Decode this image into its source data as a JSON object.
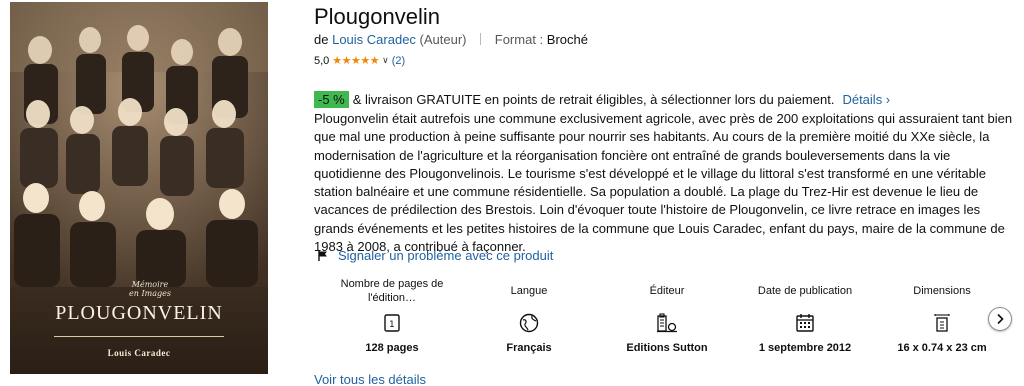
{
  "cover": {
    "series_line1": "Mémoire",
    "series_line2": "en Images",
    "title": "Plougonvelin",
    "author": "Louis Caradec"
  },
  "product": {
    "title": "Plougonvelin",
    "by_prefix": "de",
    "author": "Louis Caradec",
    "author_role": "(Auteur)",
    "format_label": "Format :",
    "format_value": "Broché",
    "rating_value": "5,0",
    "rating_stars": "★★★★★",
    "rating_count": "(2)"
  },
  "promo": {
    "badge": "-5 %",
    "text": "& livraison GRATUITE en points de retrait éligibles, à sélectionner lors du paiement.",
    "details_link": "Détails ›"
  },
  "description": "Plougonvelin était autrefois une commune exclusivement agricole, avec près de 200 exploitations qui assuraient tant bien que mal une production à peine suffisante pour nourrir ses habitants. Au cours de la première moitié du XXe siècle, la modernisation de l'agriculture et la réorganisation foncière ont entraîné de grands bouleversements dans la vie quotidienne des Plougonvelinois. Le tourisme s'est développé et le village du littoral s'est transformé en une véritable station balnéaire et une commune résidentielle. Sa population a doublé. La plage du Trez-Hir est devenue le lieu de vacances de prédilection des Brestois. Loin d'évoquer toute l'histoire de Plougonvelin, ce livre retrace en images les grands événements et les petites histoires de la commune que Louis Caradec, enfant du pays, maire de la commune de 1983 à 2008, a contribué à façonner.",
  "report_link": "Signaler un problème avec ce produit",
  "attributes": [
    {
      "label": "Nombre de pages de l'édition…",
      "value": "128 pages",
      "icon": "pages-icon"
    },
    {
      "label": "Langue",
      "value": "Français",
      "icon": "globe-icon"
    },
    {
      "label": "Éditeur",
      "value": "Editions Sutton",
      "icon": "publisher-icon"
    },
    {
      "label": "Date de publication",
      "value": "1 septembre 2012",
      "icon": "calendar-icon"
    },
    {
      "label": "Dimensions",
      "value": "16 x 0.74 x 23 cm",
      "icon": "dimensions-icon"
    }
  ],
  "see_all_link": "Voir tous les détails",
  "colors": {
    "link": "#2162a1",
    "star": "#f08804",
    "badge": "#3fb94e"
  }
}
